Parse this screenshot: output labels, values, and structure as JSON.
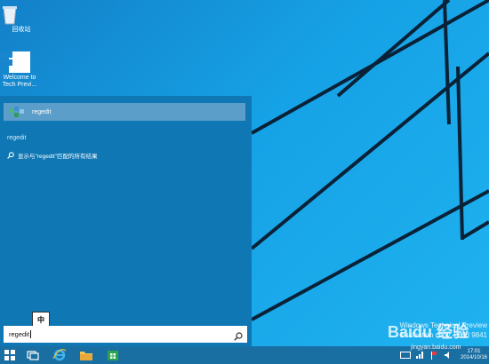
{
  "desktop": {
    "icons": [
      {
        "label": "回收站",
        "icon": "recycle-bin-icon"
      },
      {
        "label": "Welcome to Tech Previ...",
        "icon": "windows-logo-icon"
      }
    ]
  },
  "start_panel": {
    "top_result": {
      "label": "regedit",
      "icon": "regedit-icon"
    },
    "section_header": "regedit",
    "web_result": {
      "label": "显示与\"regedit\"匹配的所有结果",
      "icon": "search-icon"
    }
  },
  "ime": {
    "label": "中"
  },
  "search": {
    "value": "regedit",
    "icon": "search-icon"
  },
  "taskbar": {
    "items": [
      {
        "name": "start-button",
        "icon": "windows-logo-icon"
      },
      {
        "name": "task-view-button",
        "icon": "task-view-icon"
      },
      {
        "name": "internet-explorer",
        "icon": "ie-icon"
      },
      {
        "name": "file-explorer",
        "icon": "folder-icon"
      },
      {
        "name": "store",
        "icon": "store-icon"
      }
    ],
    "clock": {
      "time": "17:01",
      "date": "2014/10/16"
    }
  },
  "watermark": {
    "line1": "Windows Technical Preview",
    "line2": "Evaluation copy. Build 9841",
    "brand": "Baidu 经验",
    "domain": "jingyan.baidu.com"
  },
  "colors": {
    "panel": "#0f77b4",
    "highlight": "#5a9ec9",
    "taskbar": "#1a6fa2",
    "desktop": "#16a2e6"
  }
}
